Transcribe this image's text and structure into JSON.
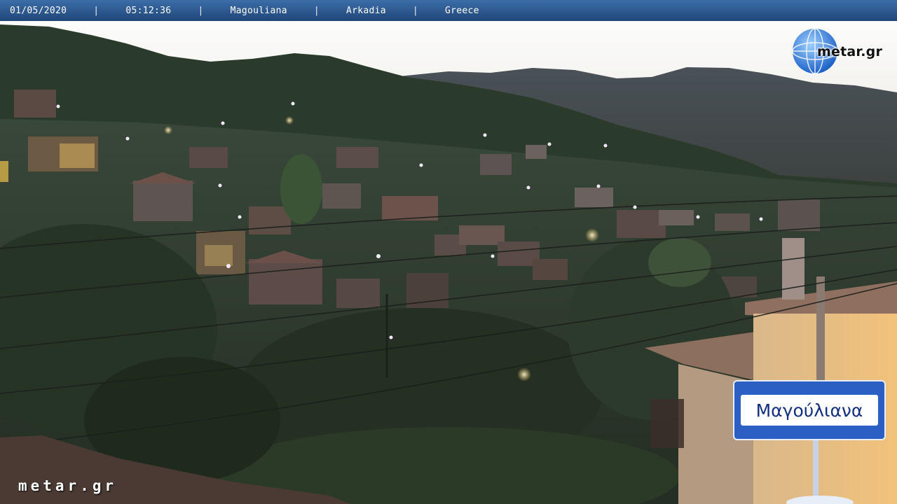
{
  "overlay": {
    "date": "01/05/2020",
    "time": "05:12:36",
    "village": "Magouliana",
    "region": "Arkadia",
    "country": "Greece",
    "separator": "|"
  },
  "logo": {
    "text": "metar.gr"
  },
  "watermark": {
    "text": "metar.gr"
  },
  "sign": {
    "text": "Μαγούλιανα"
  },
  "colors": {
    "bar": "#2a578f",
    "sign_blue": "#2b5fc4",
    "sky": "#f2f0ea",
    "vegetation": "#2c3a2a",
    "roof": "#6a5048",
    "lamp": "#f3e6ff",
    "wall_lit": "#e3b773"
  },
  "icons": [
    "globe-icon"
  ]
}
